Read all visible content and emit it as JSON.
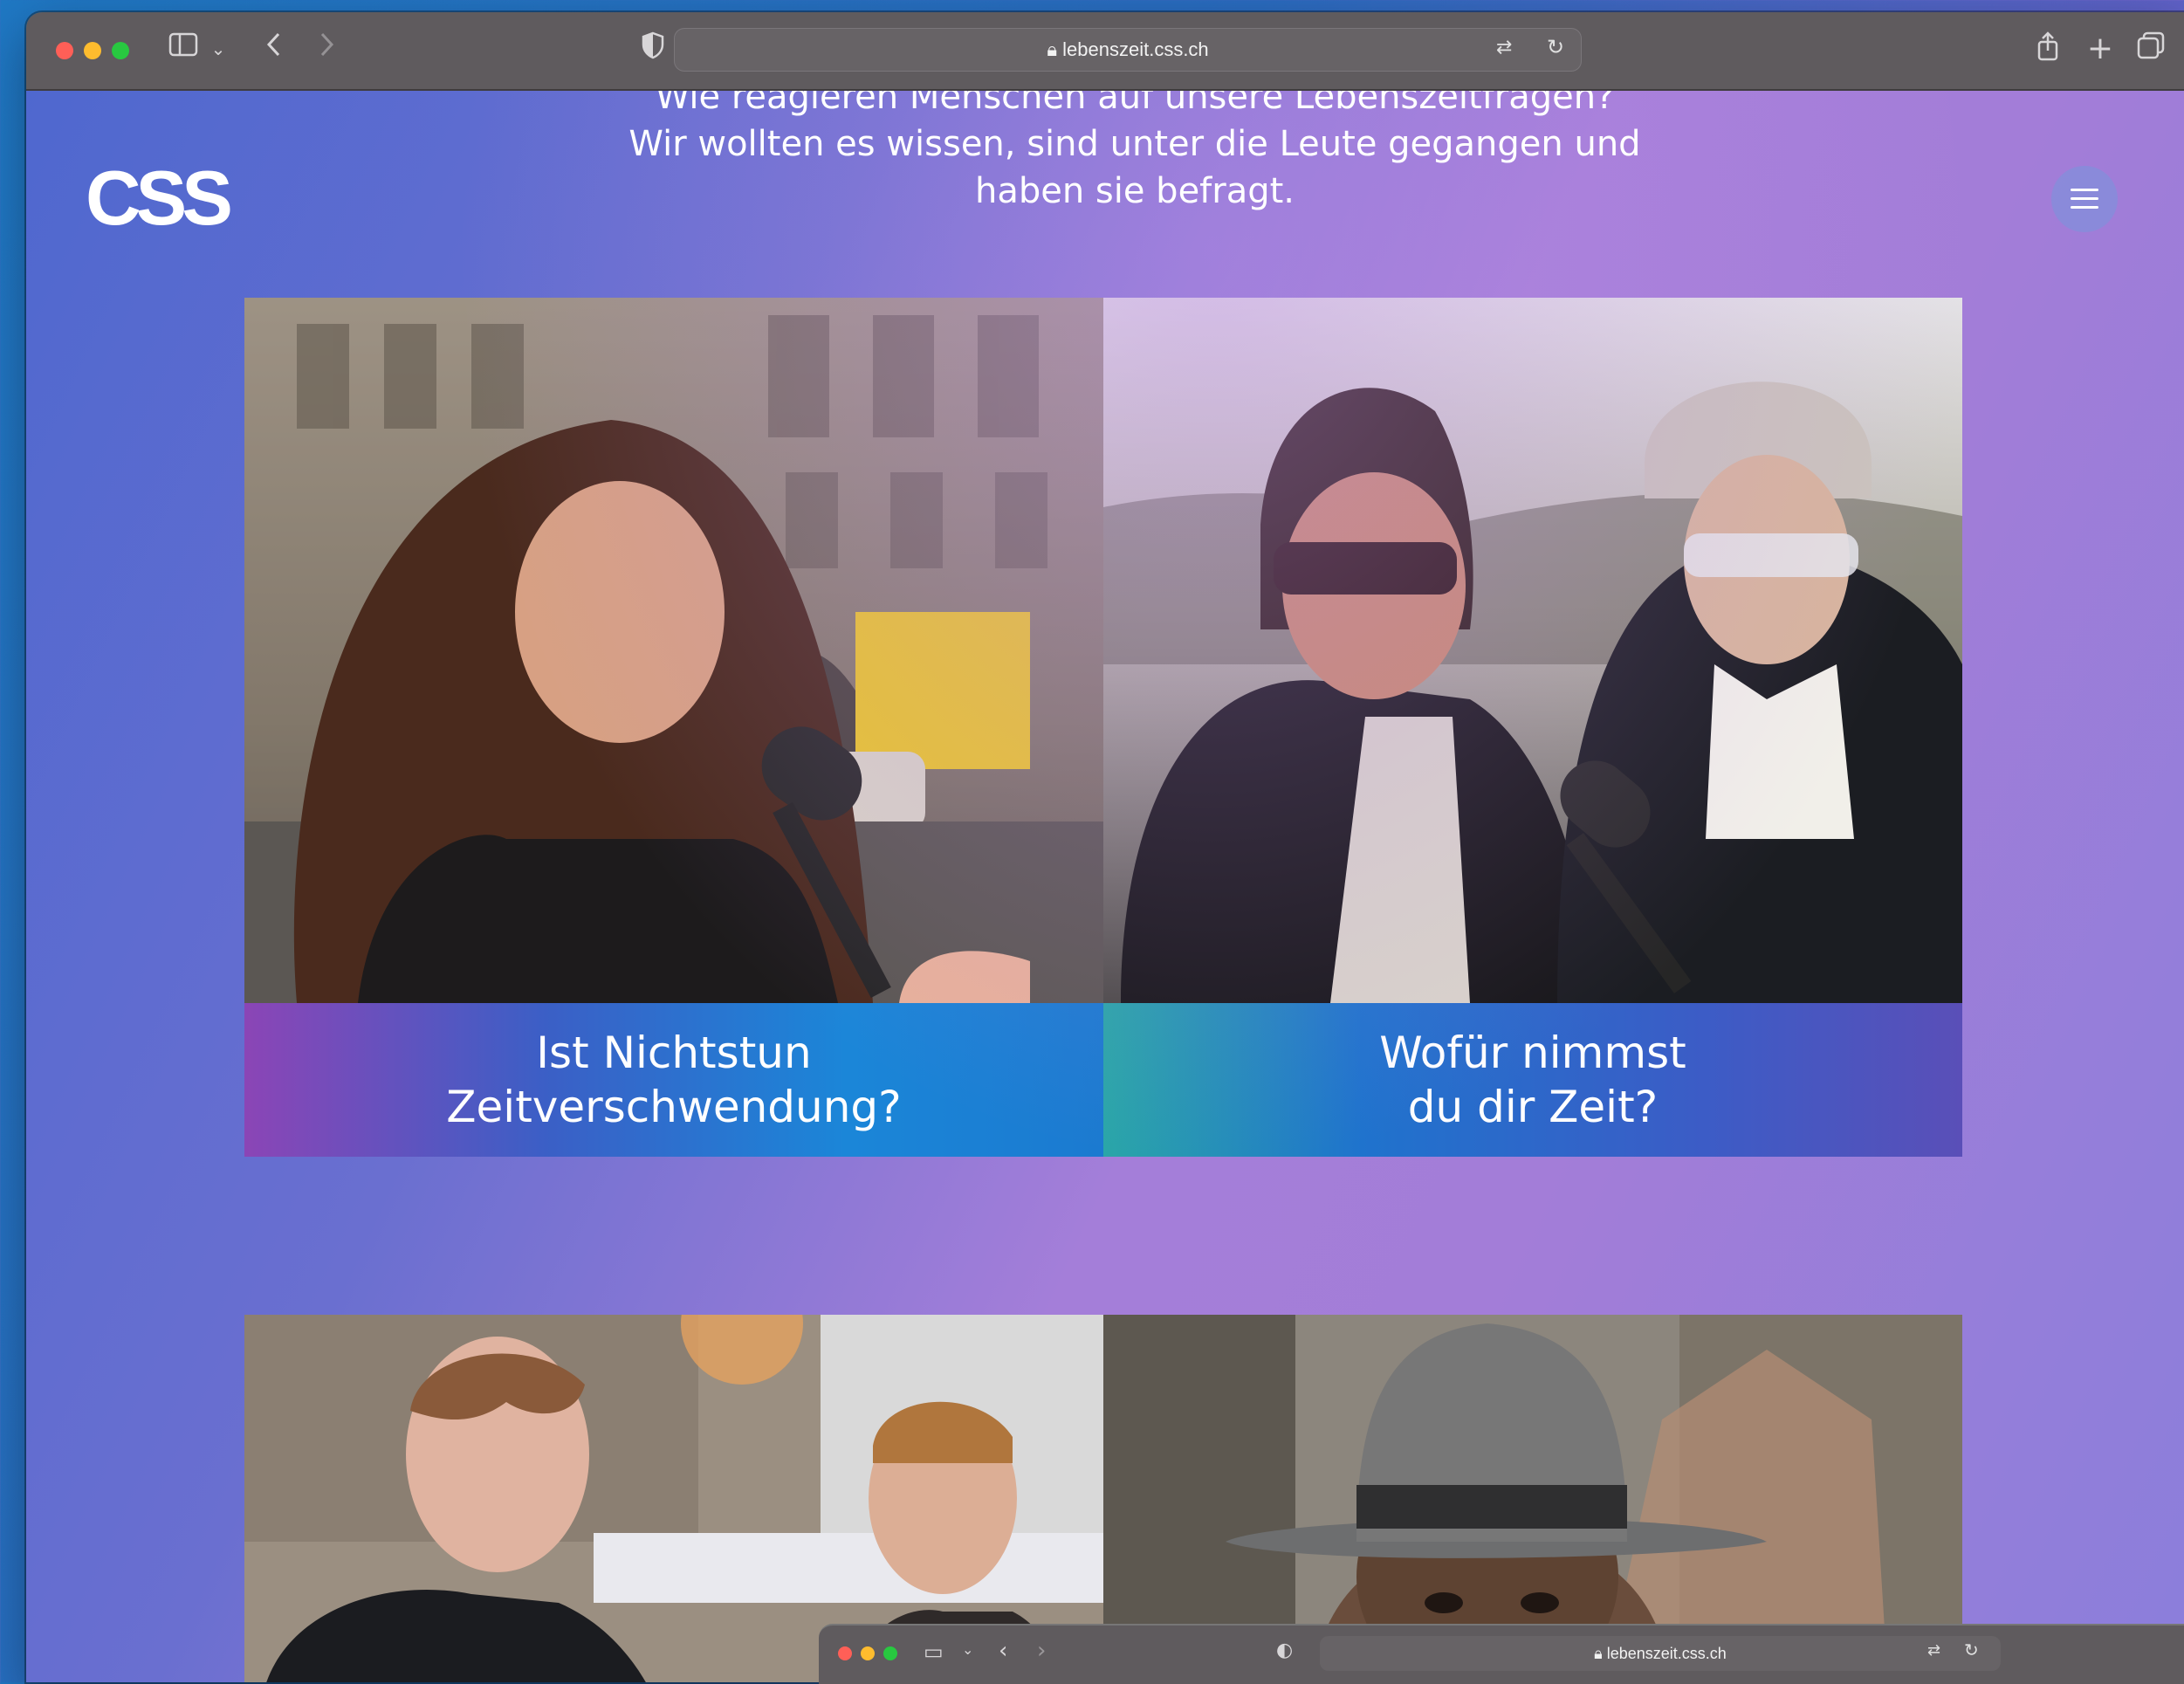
{
  "browser": {
    "url": "lebenszeit.css.ch",
    "icons": {
      "sidebar": "sidebar-icon",
      "back": "chevron-left-icon",
      "forward": "chevron-right-icon",
      "shield": "shield-icon",
      "lock": "lock-icon",
      "translate": "translate-icon",
      "reload": "reload-icon",
      "share": "share-icon",
      "new_tab": "plus-icon",
      "tabs": "tabs-overview-icon"
    },
    "traffic_lights": [
      "#ff5f57",
      "#febc2e",
      "#28c840"
    ]
  },
  "site": {
    "logo_text": "CSS",
    "intro_line1": "Wie reagieren Menschen auf unsere Lebenszeitfragen?",
    "intro_line2": "Wir wollten es wissen, sind unter die Leute gegangen und",
    "intro_line3": "haben sie befragt."
  },
  "cards": [
    {
      "line1": "Ist Nichtstun",
      "line2": "Zeitverschwendung?"
    },
    {
      "line1": "Wofür nimmst",
      "line2": "du dir Zeit?"
    }
  ],
  "second_window": {
    "url": "lebenszeit.css.ch"
  }
}
